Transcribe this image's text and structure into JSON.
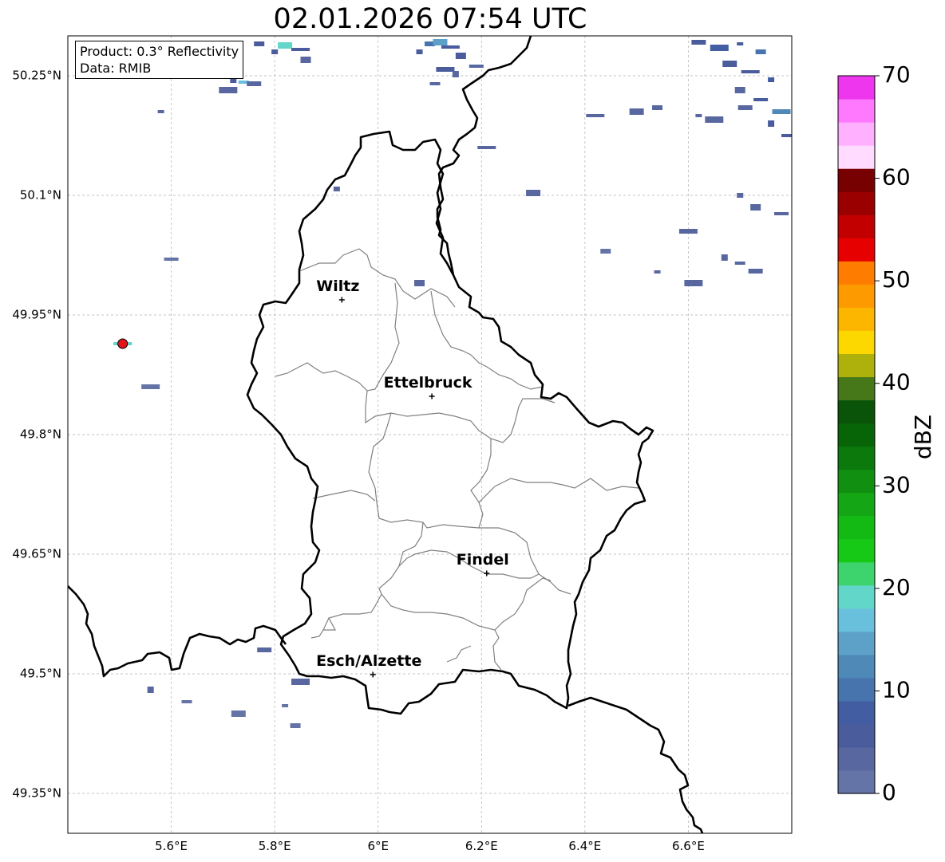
{
  "title": "02.01.2026 07:54 UTC",
  "info": {
    "product": "Product: 0.3° Reflectivity",
    "data": "Data: RMIB"
  },
  "map": {
    "lon_range": [
      5.4,
      6.8
    ],
    "lat_range": [
      49.3,
      50.3
    ],
    "x_ticks": [
      {
        "value": 5.6,
        "label": "5.6°E"
      },
      {
        "value": 5.8,
        "label": "5.8°E"
      },
      {
        "value": 6.0,
        "label": "6°E"
      },
      {
        "value": 6.2,
        "label": "6.2°E"
      },
      {
        "value": 6.4,
        "label": "6.4°E"
      },
      {
        "value": 6.6,
        "label": "6.6°E"
      }
    ],
    "y_ticks": [
      {
        "value": 50.25,
        "label": "50.25°N"
      },
      {
        "value": 50.1,
        "label": "50.1°N"
      },
      {
        "value": 49.95,
        "label": "49.95°N"
      },
      {
        "value": 49.8,
        "label": "49.8°N"
      },
      {
        "value": 49.65,
        "label": "49.65°N"
      },
      {
        "value": 49.5,
        "label": "49.5°N"
      },
      {
        "value": 49.35,
        "label": "49.35°N"
      }
    ],
    "cities": [
      {
        "name": "Wiltz",
        "lon": 5.93,
        "lat": 49.969
      },
      {
        "name": "Ettelbruck",
        "lon": 6.104,
        "lat": 49.848
      },
      {
        "name": "Findel",
        "lon": 6.21,
        "lat": 49.626
      },
      {
        "name": "Esch/Alzette",
        "lon": 5.99,
        "lat": 49.499
      }
    ],
    "radar_site": {
      "lon": 5.506,
      "lat": 49.914,
      "color": "#e0151b"
    },
    "colors": {
      "border": "#000000",
      "cantons": "#808080",
      "grid": "#b0b0b0"
    }
  },
  "colorbar": {
    "label": "dBZ",
    "ticks": [
      0,
      10,
      20,
      30,
      40,
      50,
      60,
      70
    ],
    "range": [
      0,
      70
    ],
    "step": 2.5,
    "colors": [
      "#6574a7",
      "#5867a0",
      "#4a5c9c",
      "#435da2",
      "#4874ae",
      "#4e89b8",
      "#5da1c9",
      "#69c0dc",
      "#61d6c9",
      "#3dd46d",
      "#17c917",
      "#14ba14",
      "#14a614",
      "#118f11",
      "#0b790b",
      "#076407",
      "#0a540a",
      "#46781a",
      "#aeb10b",
      "#fcd700",
      "#fdb600",
      "#fd9a00",
      "#fe7c00",
      "#e70000",
      "#c20000",
      "#9a0000",
      "#770000",
      "#ffdcff",
      "#ffb1ff",
      "#ff79ff",
      "#ee36ee"
    ]
  },
  "radar_echoes": [
    {
      "lon": 5.72,
      "lat": 50.292,
      "dbz": 4
    },
    {
      "lon": 5.77,
      "lat": 50.29,
      "dbz": 6
    },
    {
      "lon": 5.82,
      "lat": 50.288,
      "dbz": 22
    },
    {
      "lon": 5.85,
      "lat": 50.283,
      "dbz": 6
    },
    {
      "lon": 5.8,
      "lat": 50.28,
      "dbz": 5
    },
    {
      "lon": 5.86,
      "lat": 50.27,
      "dbz": 3
    },
    {
      "lon": 5.66,
      "lat": 50.258,
      "dbz": 2
    },
    {
      "lon": 5.68,
      "lat": 50.255,
      "dbz": 3
    },
    {
      "lon": 5.72,
      "lat": 50.245,
      "dbz": 5
    },
    {
      "lon": 5.74,
      "lat": 50.242,
      "dbz": 18
    },
    {
      "lon": 5.76,
      "lat": 50.24,
      "dbz": 4
    },
    {
      "lon": 5.71,
      "lat": 50.232,
      "dbz": 3
    },
    {
      "lon": 5.58,
      "lat": 50.205,
      "dbz": 3
    },
    {
      "lon": 6.1,
      "lat": 50.29,
      "dbz": 10
    },
    {
      "lon": 6.12,
      "lat": 50.292,
      "dbz": 16
    },
    {
      "lon": 6.14,
      "lat": 50.286,
      "dbz": 6
    },
    {
      "lon": 6.08,
      "lat": 50.28,
      "dbz": 5
    },
    {
      "lon": 6.16,
      "lat": 50.275,
      "dbz": 5
    },
    {
      "lon": 6.19,
      "lat": 50.262,
      "dbz": 4
    },
    {
      "lon": 6.13,
      "lat": 50.258,
      "dbz": 7
    },
    {
      "lon": 6.15,
      "lat": 50.252,
      "dbz": 3
    },
    {
      "lon": 6.11,
      "lat": 50.24,
      "dbz": 4
    },
    {
      "lon": 6.62,
      "lat": 50.292,
      "dbz": 6
    },
    {
      "lon": 6.66,
      "lat": 50.285,
      "dbz": 8
    },
    {
      "lon": 6.7,
      "lat": 50.29,
      "dbz": 5
    },
    {
      "lon": 6.74,
      "lat": 50.28,
      "dbz": 12
    },
    {
      "lon": 6.68,
      "lat": 50.265,
      "dbz": 7
    },
    {
      "lon": 6.72,
      "lat": 50.255,
      "dbz": 6
    },
    {
      "lon": 6.76,
      "lat": 50.245,
      "dbz": 9
    },
    {
      "lon": 6.7,
      "lat": 50.232,
      "dbz": 4
    },
    {
      "lon": 6.74,
      "lat": 50.22,
      "dbz": 5
    },
    {
      "lon": 6.78,
      "lat": 50.205,
      "dbz": 14
    },
    {
      "lon": 6.76,
      "lat": 50.19,
      "dbz": 6
    },
    {
      "lon": 6.79,
      "lat": 50.175,
      "dbz": 7
    },
    {
      "lon": 6.71,
      "lat": 50.21,
      "dbz": 3
    },
    {
      "lon": 6.65,
      "lat": 50.195,
      "dbz": 4
    },
    {
      "lon": 6.62,
      "lat": 50.2,
      "dbz": 3
    },
    {
      "lon": 6.54,
      "lat": 50.21,
      "dbz": 3
    },
    {
      "lon": 6.5,
      "lat": 50.205,
      "dbz": 3
    },
    {
      "lon": 6.42,
      "lat": 50.2,
      "dbz": 3
    },
    {
      "lon": 6.7,
      "lat": 50.1,
      "dbz": 4
    },
    {
      "lon": 6.73,
      "lat": 50.085,
      "dbz": 4
    },
    {
      "lon": 6.78,
      "lat": 50.077,
      "dbz": 4
    },
    {
      "lon": 6.6,
      "lat": 50.055,
      "dbz": 3
    },
    {
      "lon": 6.67,
      "lat": 50.022,
      "dbz": 3
    },
    {
      "lon": 6.7,
      "lat": 50.015,
      "dbz": 3
    },
    {
      "lon": 6.73,
      "lat": 50.005,
      "dbz": 3
    },
    {
      "lon": 6.61,
      "lat": 49.99,
      "dbz": 3
    },
    {
      "lon": 6.54,
      "lat": 50.004,
      "dbz": 3
    },
    {
      "lon": 6.44,
      "lat": 50.03,
      "dbz": 2
    },
    {
      "lon": 6.3,
      "lat": 50.103,
      "dbz": 3
    },
    {
      "lon": 6.21,
      "lat": 50.16,
      "dbz": 3
    },
    {
      "lon": 5.92,
      "lat": 50.108,
      "dbz": 3
    },
    {
      "lon": 6.08,
      "lat": 49.99,
      "dbz": 3
    },
    {
      "lon": 5.6,
      "lat": 50.02,
      "dbz": 2
    },
    {
      "lon": 5.56,
      "lat": 49.86,
      "dbz": 2
    },
    {
      "lon": 5.56,
      "lat": 49.48,
      "dbz": 3
    },
    {
      "lon": 5.63,
      "lat": 49.465,
      "dbz": 2
    },
    {
      "lon": 5.78,
      "lat": 49.53,
      "dbz": 3
    },
    {
      "lon": 5.85,
      "lat": 49.49,
      "dbz": 3
    },
    {
      "lon": 5.82,
      "lat": 49.46,
      "dbz": 2
    },
    {
      "lon": 5.84,
      "lat": 49.435,
      "dbz": 2
    },
    {
      "lon": 5.73,
      "lat": 49.45,
      "dbz": 2
    },
    {
      "lon": 5.506,
      "lat": 49.914,
      "dbz": 20
    }
  ]
}
